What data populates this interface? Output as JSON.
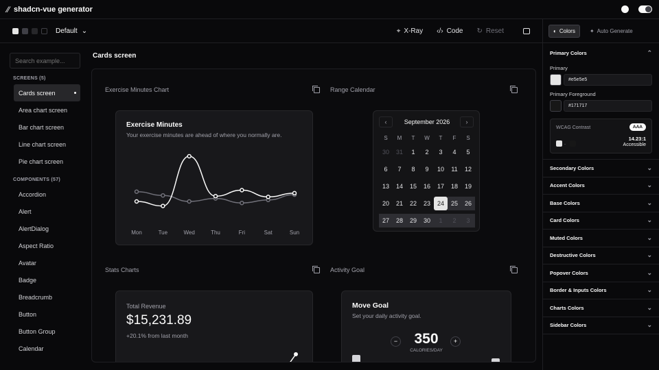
{
  "app": {
    "title": "shadcn-vue generator"
  },
  "toolbar": {
    "theme": "Default",
    "xray": "X-Ray",
    "code": "Code",
    "reset": "Reset"
  },
  "sidebar": {
    "search_placeholder": "Search example...",
    "screens_title": "SCREENS (5)",
    "screens": [
      "Cards screen",
      "Area chart screen",
      "Bar chart screen",
      "Line chart screen",
      "Pie chart screen"
    ],
    "components_title": "COMPONENTS (57)",
    "components": [
      "Accordion",
      "Alert",
      "AlertDialog",
      "Aspect Ratio",
      "Avatar",
      "Badge",
      "Breadcrumb",
      "Button",
      "Button Group",
      "Calendar"
    ]
  },
  "main": {
    "title": "Cards screen",
    "blocks": {
      "exercise_label": "Exercise Minutes Chart",
      "calendar_label": "Range Calendar",
      "stats_label": "Stats Charts",
      "activity_label": "Activity Goal"
    }
  },
  "exercise": {
    "title": "Exercise Minutes",
    "subtitle": "Your exercise minutes are ahead of where you normally are."
  },
  "calendar": {
    "month": "September 2026",
    "weekdays": [
      "S",
      "M",
      "T",
      "W",
      "T",
      "F",
      "S"
    ],
    "weeks": [
      [
        "30",
        "31",
        "1",
        "2",
        "3",
        "4",
        "5"
      ],
      [
        "6",
        "7",
        "8",
        "9",
        "10",
        "11",
        "12"
      ],
      [
        "13",
        "14",
        "15",
        "16",
        "17",
        "18",
        "19"
      ],
      [
        "20",
        "21",
        "22",
        "23",
        "24",
        "25",
        "26"
      ],
      [
        "27",
        "28",
        "29",
        "30",
        "1",
        "2",
        "3"
      ]
    ]
  },
  "stats": {
    "label": "Total Revenue",
    "value": "$15,231.89",
    "change": "+20.1% from last month"
  },
  "goal": {
    "title": "Move Goal",
    "subtitle": "Set your daily activity goal.",
    "value": "350",
    "unit": "CALORIES/DAY",
    "minus": "−",
    "plus": "+"
  },
  "rightpanel": {
    "tab_colors": "Colors",
    "tab_auto": "Auto Generate",
    "primary_title": "Primary Colors",
    "primary_label": "Primary",
    "primary_hex": "#e5e5e5",
    "primary_fg_label": "Primary Foreground",
    "primary_fg_hex": "#171717",
    "wcag_label": "WCAG Contrast",
    "wcag_badge": "AAA",
    "wcag_ratio": "14.23:1",
    "wcag_status": "Accessible",
    "sections": [
      "Secondary Colors",
      "Accent Colors",
      "Base Colors",
      "Card Colors",
      "Muted Colors",
      "Destructive Colors",
      "Popover Colors",
      "Border & Inputs Colors",
      "Charts Colors",
      "Sidebar Colors"
    ]
  },
  "colors": {
    "background": "#09090b",
    "card": "#18181b",
    "primary": "#e5e5e5",
    "primary_foreground": "#171717",
    "line_main": "#fafafa",
    "line_secondary": "#71717a"
  },
  "chart_data": {
    "type": "line",
    "categories": [
      "Mon",
      "Tue",
      "Wed",
      "Thu",
      "Fri",
      "Sat",
      "Sun"
    ],
    "series": [
      {
        "values": [
          300,
          240,
          900,
          370,
          450,
          360,
          410
        ]
      },
      {
        "values": [
          430,
          380,
          300,
          340,
          280,
          320,
          390
        ]
      }
    ]
  }
}
